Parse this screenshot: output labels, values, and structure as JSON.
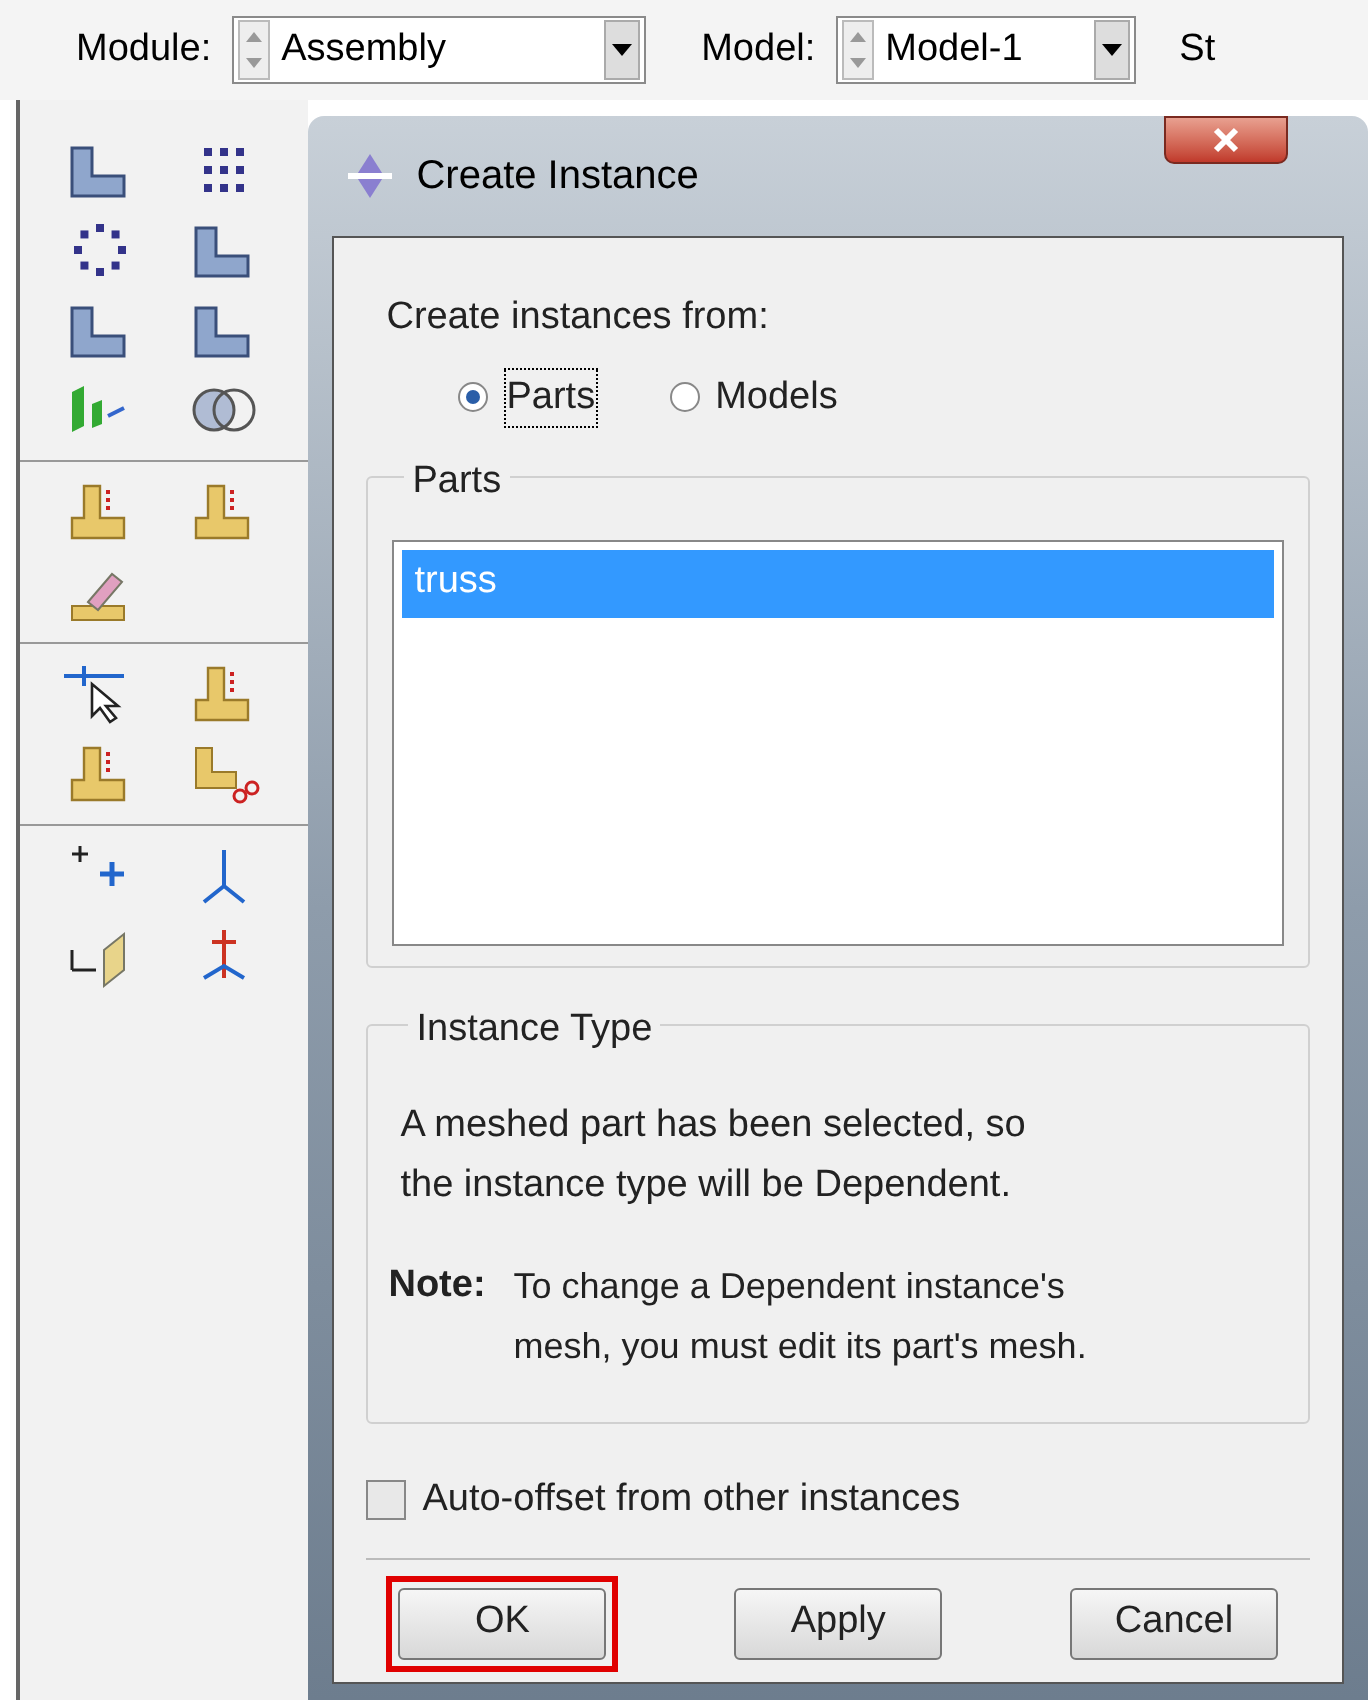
{
  "toolbar": {
    "module": {
      "label": "Module:",
      "value": "Assembly"
    },
    "model": {
      "label": "Model:",
      "value": "Model-1"
    },
    "cut_label": "St"
  },
  "dialog": {
    "title": "Create Instance",
    "source": {
      "label": "Create instances from:",
      "options": [
        {
          "label": "Parts",
          "selected": true
        },
        {
          "label": "Models",
          "selected": false
        }
      ]
    },
    "parts": {
      "title": "Parts",
      "items": [
        {
          "label": "truss",
          "selected": true
        }
      ]
    },
    "instance_type": {
      "title": "Instance Type",
      "message": [
        "A meshed part has been selected, so",
        "the instance type will be Dependent."
      ],
      "note_label": "Note:",
      "note": [
        "To change a Dependent instance's",
        "mesh, you must edit its part's mesh."
      ]
    },
    "auto_offset": {
      "label": "Auto-offset from other instances",
      "checked": false
    },
    "buttons": [
      {
        "label": "OK",
        "highlighted": true
      },
      {
        "label": "Apply",
        "highlighted": false
      },
      {
        "label": "Cancel",
        "highlighted": false
      }
    ]
  }
}
